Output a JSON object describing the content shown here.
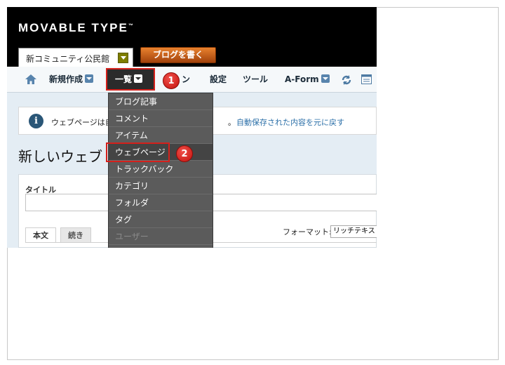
{
  "app": {
    "logo": "MOVABLE TYPE",
    "logo_tm": "™"
  },
  "header": {
    "blog_selector": "新コミュニティ公民館",
    "write_button": "ブログを書く"
  },
  "nav": {
    "items": [
      {
        "label": "新規作成"
      },
      {
        "label": "一覧"
      },
      {
        "label": "ン"
      },
      {
        "label": "設定"
      },
      {
        "label": "ツール"
      },
      {
        "label": "A-Form"
      }
    ]
  },
  "callouts": [
    "1",
    "2"
  ],
  "dropdown": {
    "items": [
      {
        "label": "ブログ記事",
        "state": "normal"
      },
      {
        "label": "コメント",
        "state": "normal"
      },
      {
        "label": "アイテム",
        "state": "normal"
      },
      {
        "label": "ウェブページ",
        "state": "highlighted"
      },
      {
        "label": "トラックバック",
        "state": "normal"
      },
      {
        "label": "カテゴリ",
        "state": "normal"
      },
      {
        "label": "フォルダ",
        "state": "normal"
      },
      {
        "label": "タグ",
        "state": "normal"
      },
      {
        "label": "ユーザー",
        "state": "disabled"
      }
    ]
  },
  "message": {
    "text_left": "ウェブページは自",
    "text_mid": "。",
    "link": "自動保存された内容を元に戻す"
  },
  "page": {
    "title": "新しいウェブ"
  },
  "editor": {
    "title_label": "タイトル",
    "tabs": [
      {
        "label": "本文"
      },
      {
        "label": "続き"
      }
    ],
    "format_label": "フォーマット:",
    "format_value": "リッチテキスト"
  },
  "colors": {
    "accent_red": "#d4201b",
    "nav_blue": "#5884ad",
    "link": "#2b6fa8"
  }
}
